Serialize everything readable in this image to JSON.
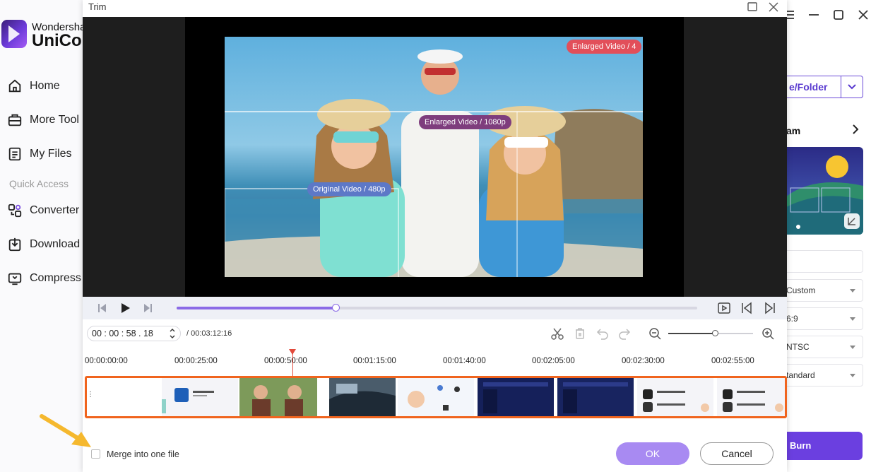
{
  "app": {
    "brand_top": "Wondersha",
    "brand_main": "UniCo",
    "nav": [
      {
        "label": "Home",
        "icon": "home-icon"
      },
      {
        "label": "More Tool",
        "icon": "toolbox-icon"
      },
      {
        "label": "My Files",
        "icon": "file-icon"
      },
      {
        "label": "Converter",
        "icon": "converter-icon"
      },
      {
        "label": "Download",
        "icon": "download-icon"
      },
      {
        "label": "Compress",
        "icon": "compress-icon"
      }
    ],
    "quick_access": "Quick Access",
    "right": {
      "add_folder": "e/Folder",
      "dream": "am",
      "fields": [
        "",
        "Custom",
        "6:9",
        "NTSC",
        "tandard"
      ],
      "burn": "Burn"
    }
  },
  "dialog": {
    "title": "Trim",
    "video_tags": {
      "enlarged_top": "Enlarged Video / 4",
      "enlarged_mid": "Enlarged Video / 1080p",
      "original": "Original Video / 480p"
    },
    "playback": {
      "progress": 0.305
    },
    "time": {
      "current": "00 : 00 : 58 . 18",
      "total": "/ 00:03:12:16"
    },
    "zoom": {
      "level": 0.55
    },
    "ruler": [
      "00:00:00:00",
      "00:00:25:00",
      "00:00:50:00",
      "00:01:15:00",
      "00:01:40:00",
      "00:02:05:00",
      "00:02:30:00",
      "00:02:55:00"
    ],
    "merge_label": "Merge into one file",
    "ok": "OK",
    "cancel": "Cancel",
    "colors": {
      "accent": "#8a6ae6",
      "trim_border": "#f0641e",
      "arrow": "#f5b82e"
    }
  }
}
